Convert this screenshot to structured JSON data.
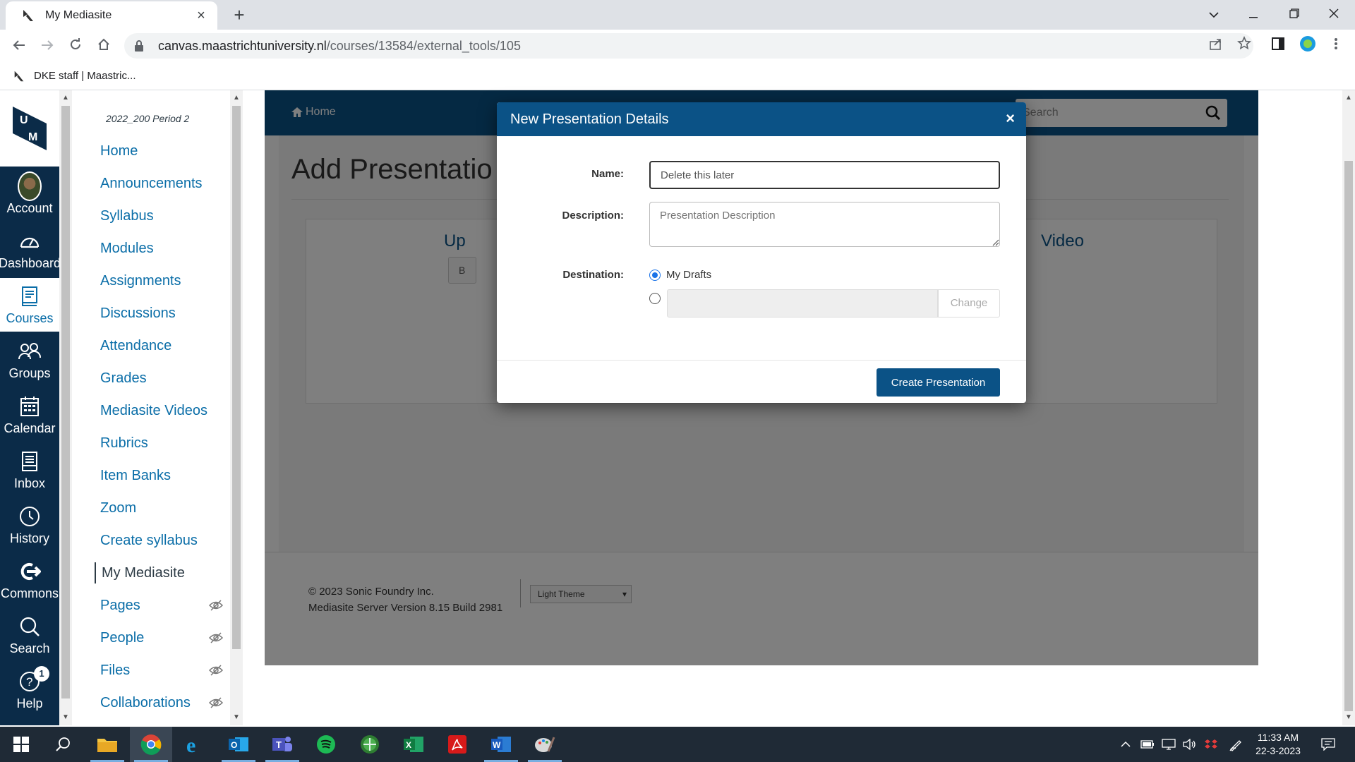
{
  "browser": {
    "tab_title": "My Mediasite",
    "url_host": "canvas.maastrichtuniversity.nl",
    "url_path": "/courses/13584/external_tools/105",
    "bookmark_label": "DKE staff | Maastric..."
  },
  "global_nav": {
    "items": [
      {
        "label": "Account",
        "icon": "avatar"
      },
      {
        "label": "Dashboard",
        "icon": "dashboard-icon"
      },
      {
        "label": "Courses",
        "icon": "courses-icon",
        "active": true
      },
      {
        "label": "Groups",
        "icon": "groups-icon"
      },
      {
        "label": "Calendar",
        "icon": "calendar-icon"
      },
      {
        "label": "Inbox",
        "icon": "inbox-icon"
      },
      {
        "label": "History",
        "icon": "history-icon"
      },
      {
        "label": "Commons",
        "icon": "commons-icon"
      },
      {
        "label": "Search",
        "icon": "search-icon"
      },
      {
        "label": "Help",
        "icon": "help-icon",
        "badge": "1"
      }
    ]
  },
  "course_nav": {
    "course_code": "2022_200 Period 2",
    "items": [
      {
        "label": "Home"
      },
      {
        "label": "Announcements"
      },
      {
        "label": "Syllabus"
      },
      {
        "label": "Modules"
      },
      {
        "label": "Assignments"
      },
      {
        "label": "Discussions"
      },
      {
        "label": "Attendance"
      },
      {
        "label": "Grades"
      },
      {
        "label": "Mediasite Videos"
      },
      {
        "label": "Rubrics"
      },
      {
        "label": "Item Banks"
      },
      {
        "label": "Zoom"
      },
      {
        "label": "Create syllabus"
      },
      {
        "label": "My Mediasite",
        "active": true
      },
      {
        "label": "Pages",
        "hidden": true
      },
      {
        "label": "People",
        "hidden": true
      },
      {
        "label": "Files",
        "hidden": true
      },
      {
        "label": "Collaborations",
        "hidden": true
      }
    ]
  },
  "mediasite": {
    "home_label": "Home",
    "search_placeholder": "Search",
    "page_title": "Add Presentatio",
    "upload_partial": "Up",
    "video_partial": "Video",
    "button_partial": "B",
    "copyright": "© 2023 Sonic Foundry Inc.",
    "version": "Mediasite Server Version 8.15 Build 2981",
    "theme_selected": "Light Theme"
  },
  "modal": {
    "title": "New Presentation Details",
    "close_label": "×",
    "name_label": "Name:",
    "name_value": "Delete this later",
    "description_label": "Description:",
    "description_placeholder": "Presentation Description",
    "destination_label": "Destination:",
    "drafts_label": "My Drafts",
    "change_label": "Change",
    "create_label": "Create Presentation"
  },
  "taskbar": {
    "time": "11:33 AM",
    "date": "22-3-2023"
  },
  "colors": {
    "canvas_nav": "#0b2b48",
    "link": "#0b6ea8",
    "mediasite_blue": "#0b5286"
  }
}
